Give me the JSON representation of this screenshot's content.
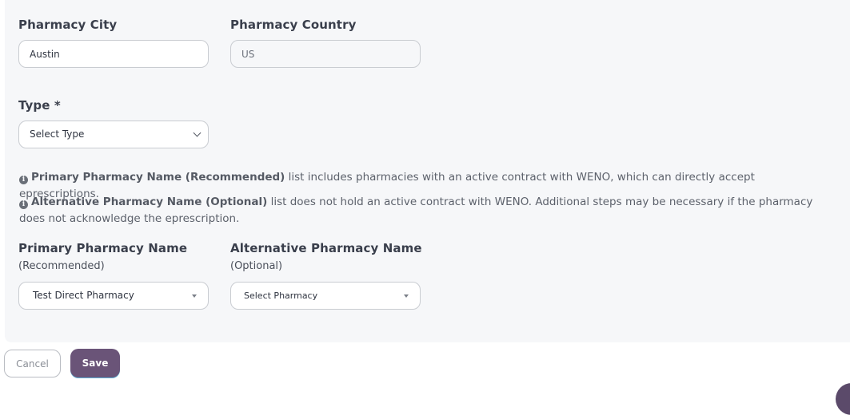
{
  "pharmacy_city": {
    "label": "Pharmacy City",
    "value": "Austin"
  },
  "pharmacy_country": {
    "label": "Pharmacy Country",
    "value": "US"
  },
  "type": {
    "label": "Type *",
    "selected": "Select Type"
  },
  "info": {
    "primary_bold": "Primary Pharmacy Name (Recommended)",
    "primary_text": " list includes pharmacies with an active contract with WENO, which can directly accept eprescriptions.",
    "alternative_bold": "Alternative Pharmacy Name (Optional)",
    "alternative_text": " list does not hold an active contract with WENO. Additional steps may be necessary if the pharmacy does not acknowledge the eprescription."
  },
  "primary_pharmacy": {
    "label": "Primary Pharmacy Name",
    "sublabel": "(Recommended)",
    "selected": "Test Direct Pharmacy"
  },
  "alternative_pharmacy": {
    "label": "Alternative Pharmacy Name",
    "sublabel": "(Optional)",
    "selected": "Select Pharmacy"
  },
  "actions": {
    "cancel_label": "Cancel",
    "save_label": "Save"
  },
  "colors": {
    "panel_bg": "#f6f7f9",
    "accent": "#6a5478"
  },
  "icons": {
    "info": "info-circle-icon",
    "type_dropdown": "chevron-down-icon",
    "pharmacy_dropdown": "caret-down-icon"
  }
}
